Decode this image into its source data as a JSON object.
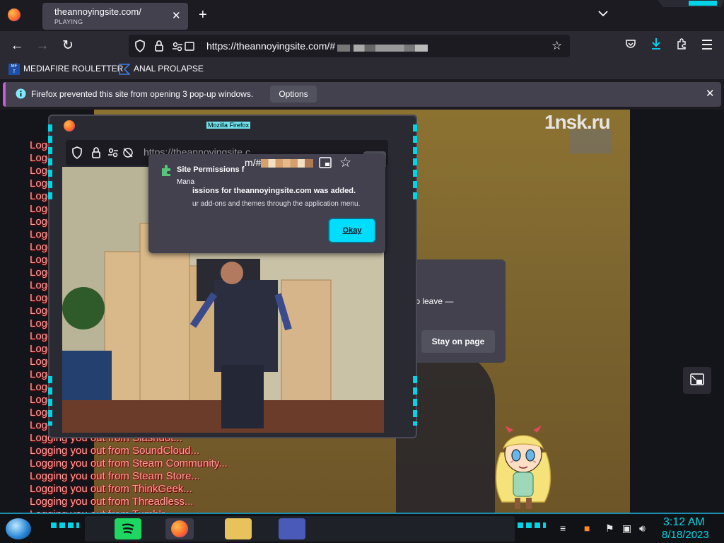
{
  "browser": {
    "tab": {
      "title": "theannoyingsite.com/",
      "subtitle": "PLAYING"
    },
    "url": {
      "host": "https://theannoyingsite.com/#"
    },
    "bookmarks": [
      {
        "label": "MEDIAFIRE ROULETTER",
        "icon": "mediafire-icon"
      },
      {
        "label": "ANAL PROLAPSE",
        "icon": "bookmark-icon"
      }
    ],
    "notification": {
      "text": "Firefox prevented this site from opening 3 pop-up windows.",
      "options_label": "Options"
    }
  },
  "page": {
    "watermark": "1nsk.ru",
    "logout_lines": [
      "Logg",
      "Logg",
      "Logg",
      "Logg",
      "Logg",
      "Logg",
      "Logg",
      "Logg",
      "Logg",
      "Logg",
      "Logg",
      "Logg",
      "Logg",
      "Logg",
      "Logg",
      "Logg",
      "Logg",
      "Logg",
      "Logg",
      "Logg",
      "Logg",
      "Logg",
      "Logging you out from Skype...",
      "Logging you out from Slashdot...",
      "Logging you out from SoundCloud...",
      "Logging you out from Steam Community...",
      "Logging you out from Steam Store...",
      "Logging you out from ThinkGeek...",
      "Logging you out from Threadless...",
      "Logging you out from Tumblr..."
    ],
    "leave_dialog": {
      "text": "to leave —",
      "stay_label": "Stay on page"
    }
  },
  "popup": {
    "window_title": "Mozilla Firefox",
    "url": "https://theannoyingsite.c",
    "url_tail": "m/#",
    "permissions": {
      "title": "Site Permissions f",
      "manage": "Mana",
      "message": "issions for theannoyingsite.com was added.",
      "sub": "ur add-ons and themes through the application menu.",
      "okay_label": "Okay"
    }
  },
  "taskbar": {
    "time": "3:12 AM",
    "date": "8/18/2023"
  },
  "colors": {
    "accent": "#00ddff",
    "notification_bar": "#c45cd6",
    "logout_text": "#f5a3a3",
    "clock": "#00d4e6"
  }
}
